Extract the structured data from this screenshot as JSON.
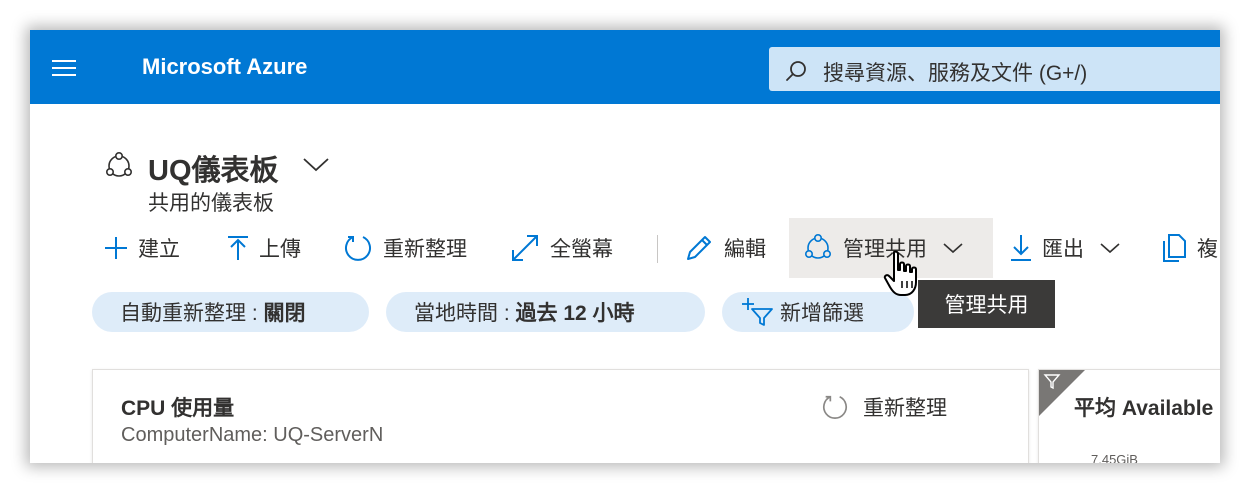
{
  "header": {
    "brand": "Microsoft Azure",
    "search_placeholder": "搜尋資源、服務及文件 (G+/)",
    "colors": {
      "bar": "#0078d4",
      "search_bg": "#cde4f7"
    }
  },
  "dashboard": {
    "title": "UQ儀表板",
    "subtitle": "共用的儀表板",
    "icons": {
      "title": "shared-dashboard-icon",
      "chevron": "chevron-down-icon"
    }
  },
  "toolbar": {
    "create": "建立",
    "upload": "上傳",
    "refresh": "重新整理",
    "fullscreen": "全螢幕",
    "edit": "編輯",
    "manage_sharing": "管理共用",
    "export": "匯出",
    "copy": "複"
  },
  "filters": {
    "auto_refresh_label": "自動重新整理 : ",
    "auto_refresh_value": "關閉",
    "local_time_label": "當地時間 : ",
    "local_time_value": "過去 12 小時",
    "add_filter": "新增篩選"
  },
  "tooltip": "管理共用",
  "tiles": [
    {
      "title": "CPU 使用量",
      "subtitle": "ComputerName: UQ-ServerN",
      "refresh": "重新整理"
    },
    {
      "title": "平均 Available",
      "value_label": "7.45GiB"
    }
  ]
}
